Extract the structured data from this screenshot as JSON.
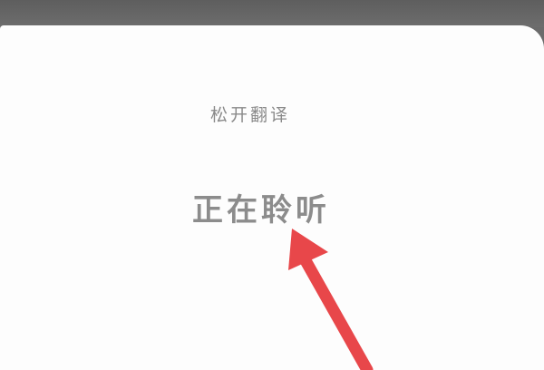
{
  "voice_panel": {
    "release_hint": "松开翻译",
    "status": "正在聆听"
  },
  "annotation": {
    "arrow_color": "#e8474a"
  }
}
